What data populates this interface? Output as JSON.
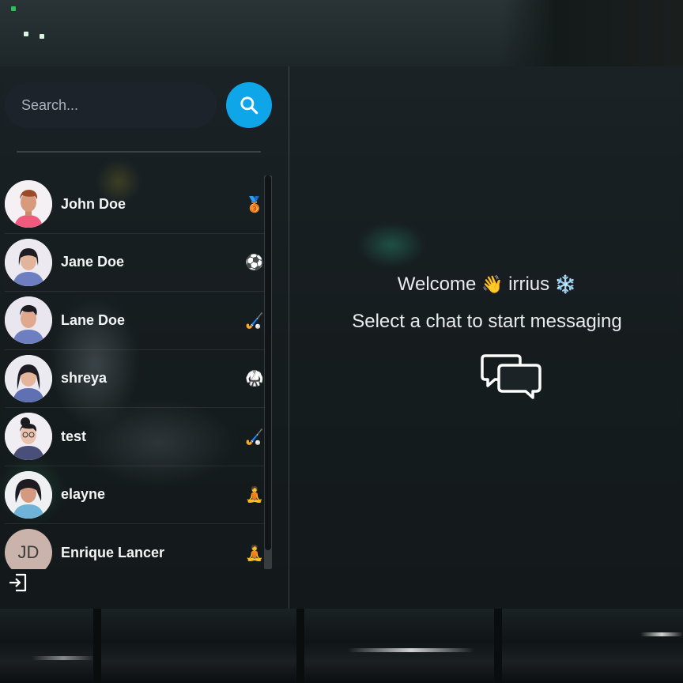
{
  "search": {
    "placeholder": "Search..."
  },
  "conversations": [
    {
      "name": "John Doe",
      "emoji": "🥉"
    },
    {
      "name": "Jane Doe",
      "emoji": "⚽"
    },
    {
      "name": "Lane Doe",
      "emoji": "🏑"
    },
    {
      "name": "shreya",
      "emoji": "🥋"
    },
    {
      "name": "test",
      "emoji": "🏑"
    },
    {
      "name": "elayne",
      "emoji": "🧘"
    },
    {
      "name": "Enrique Lancer",
      "emoji": "🧘",
      "initials": "JD"
    }
  ],
  "welcome": {
    "greeting": "Welcome",
    "wave": "👋",
    "username": "irrius",
    "snow": "❄️",
    "subtitle": "Select a chat to start messaging"
  },
  "colors": {
    "accent": "#0ea5e9",
    "input_bg": "#1d232b"
  }
}
